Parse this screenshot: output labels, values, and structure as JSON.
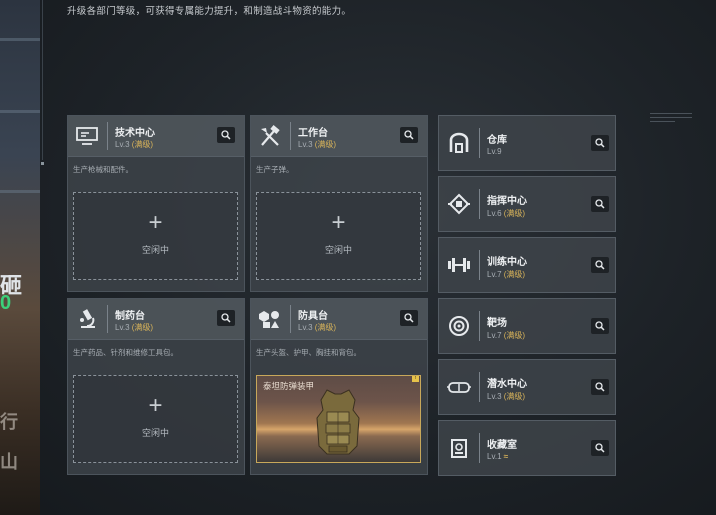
{
  "header": {
    "description": "升级各部门等级，可获得专属能力提升，和制造战斗物资的能力。"
  },
  "left_strip": {
    "frag1": "砸",
    "frag2": "0",
    "frag3": "行",
    "frag4": "山"
  },
  "cards": [
    {
      "title": "技术中心",
      "level": "Lv.3",
      "max": "(满级)",
      "desc": "生产枪械和配件。",
      "slot_label": "空闲中",
      "icon": "computer-icon"
    },
    {
      "title": "工作台",
      "level": "Lv.3",
      "max": "(满级)",
      "desc": "生产子弹。",
      "slot_label": "空闲中",
      "icon": "tools-icon"
    },
    {
      "title": "制药台",
      "level": "Lv.3",
      "max": "(满级)",
      "desc": "生产药品、针剂和维修工具包。",
      "slot_label": "空闲中",
      "icon": "microscope-icon"
    },
    {
      "title": "防具台",
      "level": "Lv.3",
      "max": "(满级)",
      "desc": "生产头盔、护甲、胸挂和背包。",
      "crafting_label": "泰坦防弹装甲",
      "corner": "!",
      "icon": "armor-parts-icon"
    }
  ],
  "side": [
    {
      "title": "仓库",
      "level": "Lv.9",
      "max": "",
      "icon": "warehouse-icon"
    },
    {
      "title": "指挥中心",
      "level": "Lv.6",
      "max": "(满级)",
      "icon": "command-icon"
    },
    {
      "title": "训练中心",
      "level": "Lv.7",
      "max": "(满级)",
      "icon": "dumbbell-icon"
    },
    {
      "title": "靶场",
      "level": "Lv.7",
      "max": "(满级)",
      "icon": "target-icon"
    },
    {
      "title": "潜水中心",
      "level": "Lv.3",
      "max": "(满级)",
      "icon": "goggles-icon"
    },
    {
      "title": "收藏室",
      "level": "Lv.1",
      "max": "",
      "chevron": "≈",
      "icon": "collection-icon"
    }
  ],
  "colors": {
    "accent_max": "#d9b45a",
    "card_bg": "#3e444a",
    "background": "#1d2227"
  }
}
